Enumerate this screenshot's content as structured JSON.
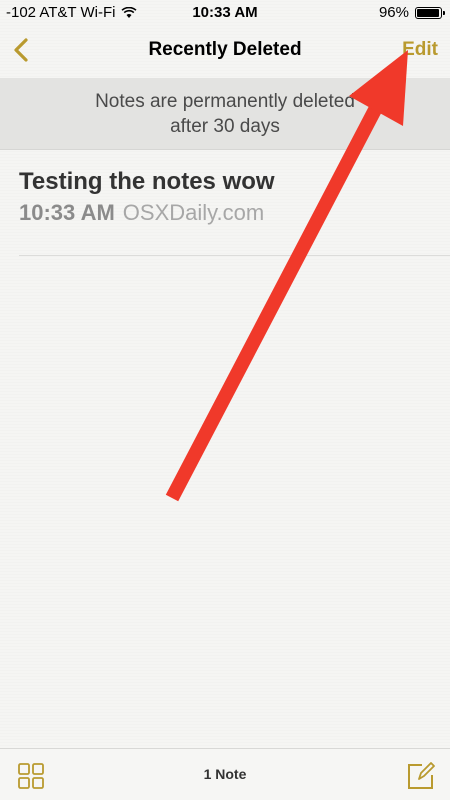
{
  "status_bar": {
    "carrier": "-102 AT&T Wi-Fi",
    "time": "10:33 AM",
    "battery_percent": "96%",
    "battery_level": 0.96
  },
  "nav": {
    "back_icon": "chevron-left-icon",
    "title": "Recently Deleted",
    "edit_label": "Edit"
  },
  "banner": {
    "text": "Notes are permanently deleted after 30 days"
  },
  "notes": [
    {
      "title": "Testing the notes wow",
      "time": "10:33 AM",
      "preview": "OSXDaily.com"
    }
  ],
  "toolbar": {
    "grid_icon": "grid-icon",
    "count_label": "1 Note",
    "compose_icon": "compose-icon"
  },
  "colors": {
    "accent": "#b99a2f",
    "arrow": "#f0392a",
    "background": "#f5f5f3"
  }
}
